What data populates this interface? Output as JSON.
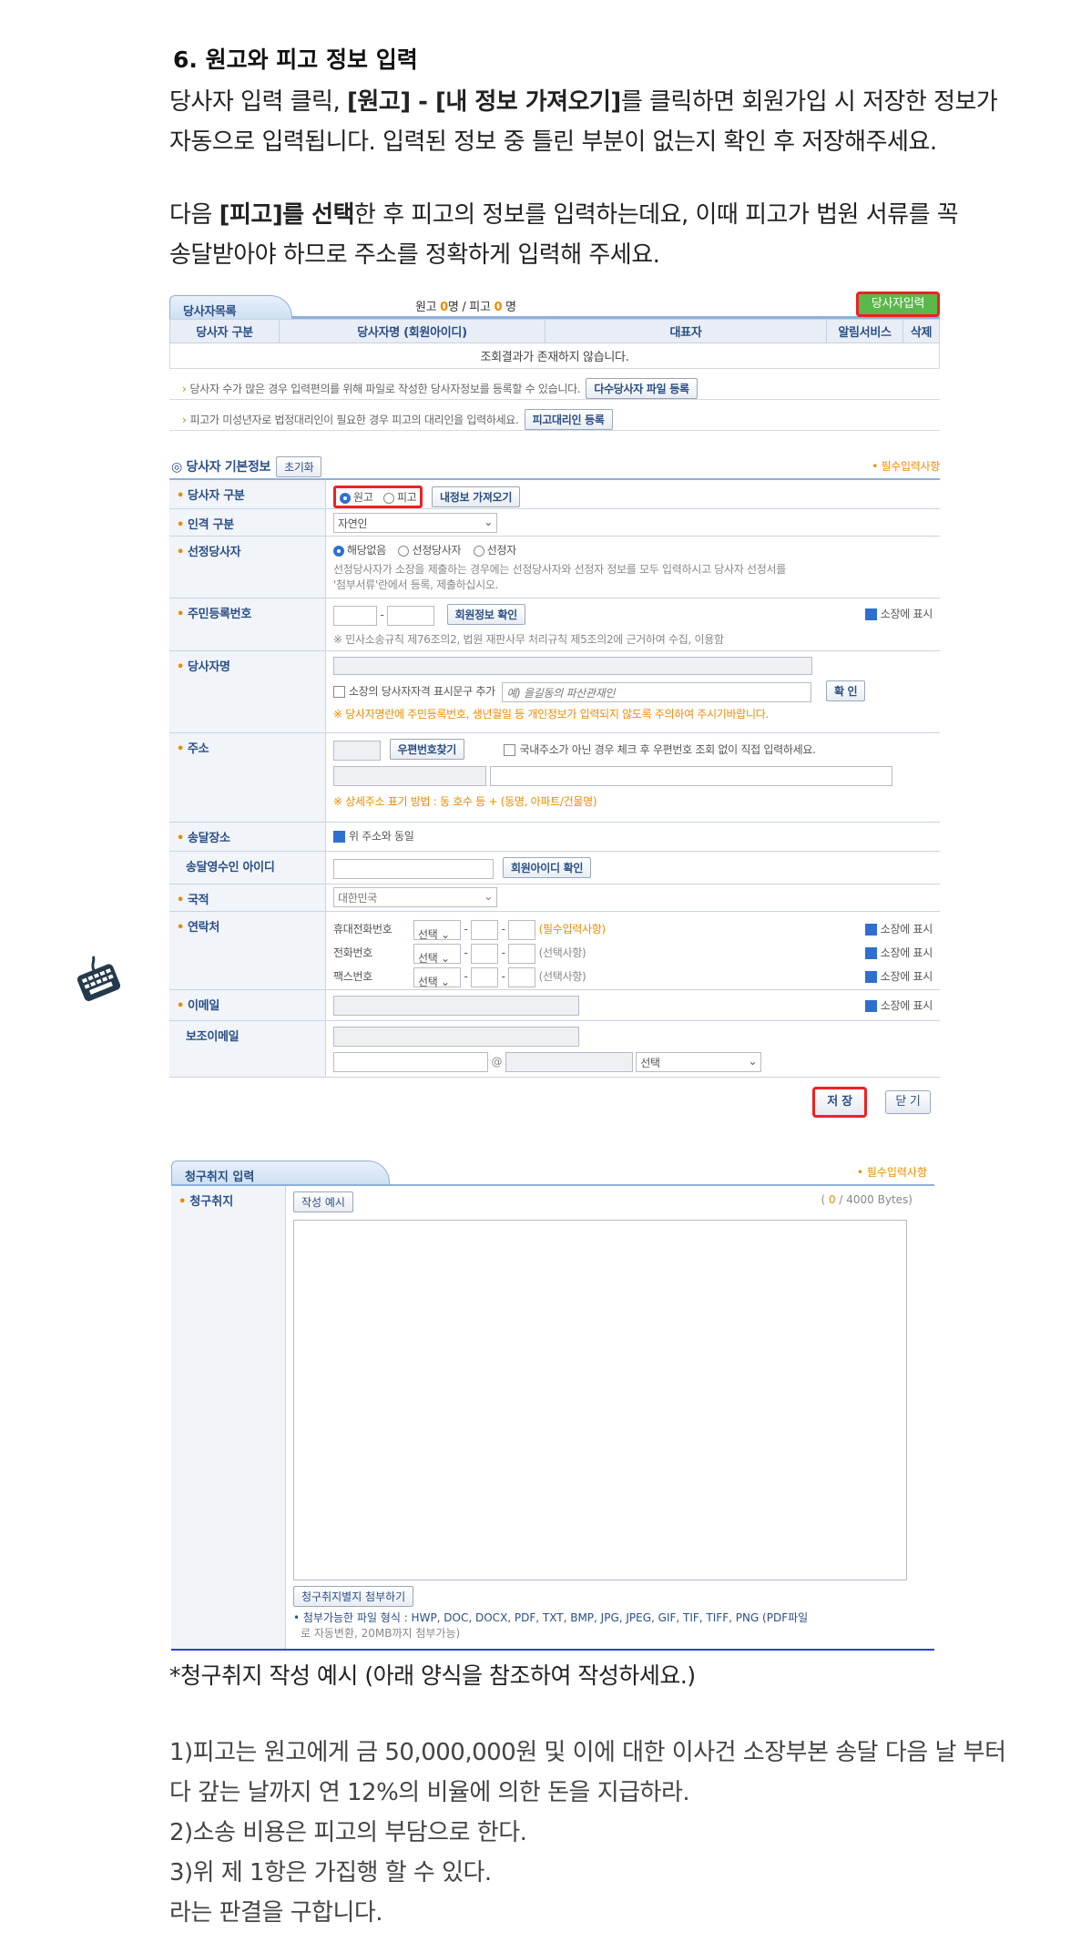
{
  "heading": "6. 원고와 피고 정보 입력",
  "para1": {
    "line1_a": "당사자 입력 클릭, ",
    "line1_b": "[원고] - [내 정보 가져오기]",
    "line1_c": "를 클릭하면 회원가입 시 저장한 정보가",
    "line2": "자동으로 입력됩니다. 입력된 정보 중 틀린 부분이 없는지 확인 후 저장해주세요."
  },
  "para2": {
    "line1_a": "다음 ",
    "line1_b": "[피고]를 선택",
    "line1_c": "한 후 피고의 정보를 입력하는데요, 이때 피고가 법원 서류를 꼭",
    "line2": "송달받아야 하므로 주소를 정확하게 입력해 주세요."
  },
  "party_panel": {
    "tab": "당사자목록",
    "count_a": "원고 ",
    "count_a_num": "0",
    "count_b": "명 / 피고 ",
    "count_b_num": "0",
    "count_c": " 명",
    "add_button": "당사자입력",
    "columns": [
      "당사자 구분",
      "당사자명 (회원아이디)",
      "대표자",
      "알림서비스",
      "삭제"
    ],
    "empty_msg": "조회결과가 존재하지 않습니다.",
    "note1": "당사자 수가 많은 경우 입력편의를 위해 파일로 작성한 당사자정보를 등록할 수 있습니다.",
    "note1_btn": "다수당사자 파일 등록",
    "note2": "피고가 미성년자로 법정대리인이 필요한 경우 피고의 대리인을 입력하세요.",
    "note2_btn": "피고대리인 등록"
  },
  "basic": {
    "title": "당사자 기본정보",
    "reset": "초기화",
    "required": "• 필수입력사항",
    "party_type_label": "당사자 구분",
    "opt_plaintiff": "원고",
    "opt_defendant": "피고",
    "myinfo_btn": "내정보 가져오기",
    "person_type_label": "인격 구분",
    "person_type_value": "자연인",
    "selected_label": "선정당사자",
    "sel_opt1": "해당없음",
    "sel_opt2": "선정당사자",
    "sel_opt3": "선정자",
    "sel_note1": "선정당사자가 소장을 제출하는 경우에는 선정당사자와 선정자 정보를 모두 입력하시고 당사자 선정서를",
    "sel_note2": "'첨부서류'란에서 등록, 제출하십시오.",
    "rrn_label": "주민등록번호",
    "rrn_btn": "회원정보 확인",
    "show_on_complaint": "소장에 표시",
    "rrn_note": "※ 민사소송규칙 제76조의2, 법원 재판사무 처리규칙 제5조의2에 근거하여 수집, 이용함",
    "name_label": "당사자명",
    "name_chk": "소장의 당사자자격 표시문구 추가",
    "name_ph": "예) 을길동의 파산관재인",
    "name_btn": "확 인",
    "name_warn": "※ 당사자명란에 주민등록번호, 생년월일 등 개인정보가 입력되지 않도록 주의하여 주시기바랍니다.",
    "addr_label": "주소",
    "zip_btn": "우편번호찾기",
    "addr_chk": "국내주소가 아닌 경우 체크 후 우편번호 조회 없이 직접 입력하세요.",
    "addr_warn": "※ 상세주소 표기 방법 : 동 호수 등 + (동명, 아파트/건물명)",
    "delivery_label": "송달장소",
    "delivery_chk": "위 주소와 동일",
    "recv_id_label": "송달영수인 아이디",
    "recv_id_btn": "회원아이디 확인",
    "country_label": "국적",
    "country_value": "대한민국",
    "contact_label": "연락처",
    "mobile": "휴대전화번호",
    "phone": "전화번호",
    "fax": "팩스번호",
    "select_word": "선택",
    "req_hint": "(필수입력사항)",
    "opt_hint": "(선택사항)",
    "email_label": "이메일",
    "sub_email_label": "보조이메일",
    "at": "@",
    "save_btn": "저 장",
    "close_btn": "닫 기"
  },
  "claim_panel": {
    "tab": "청구취지 입력",
    "required": "• 필수입력사항",
    "label": "청구취지",
    "example_btn": "작성 예시",
    "counter_a": "( ",
    "counter_num": "0",
    "counter_b": " / 4000 Bytes)",
    "attach_btn": "청구취지별지 첨부하기",
    "file_info1": "• 첨부가능한 파일 형식 : HWP, DOC, DOCX, PDF, TXT, BMP, JPG, JPEG, GIF, TIF, TIFF, PNG (PDF파일",
    "file_info2": "로 자동변환, 20MB까지 첨부가능)"
  },
  "example_title": "*청구취지 작성 예시 (아래 양식을 참조하여 작성하세요.)",
  "example_lines": [
    "1)피고는 원고에게 금 50,000,000원 및 이에 대한 이사건 소장부본 송달 다음 날 부터",
    "다 갚는 날까지 연 12%의 비율에 의한 돈을 지급하라.",
    "2)소송 비용은 피고의 부담으로 한다.",
    "3)위 제 1항은 가집행 할 수 있다.",
    "라는 판결을 구합니다."
  ]
}
